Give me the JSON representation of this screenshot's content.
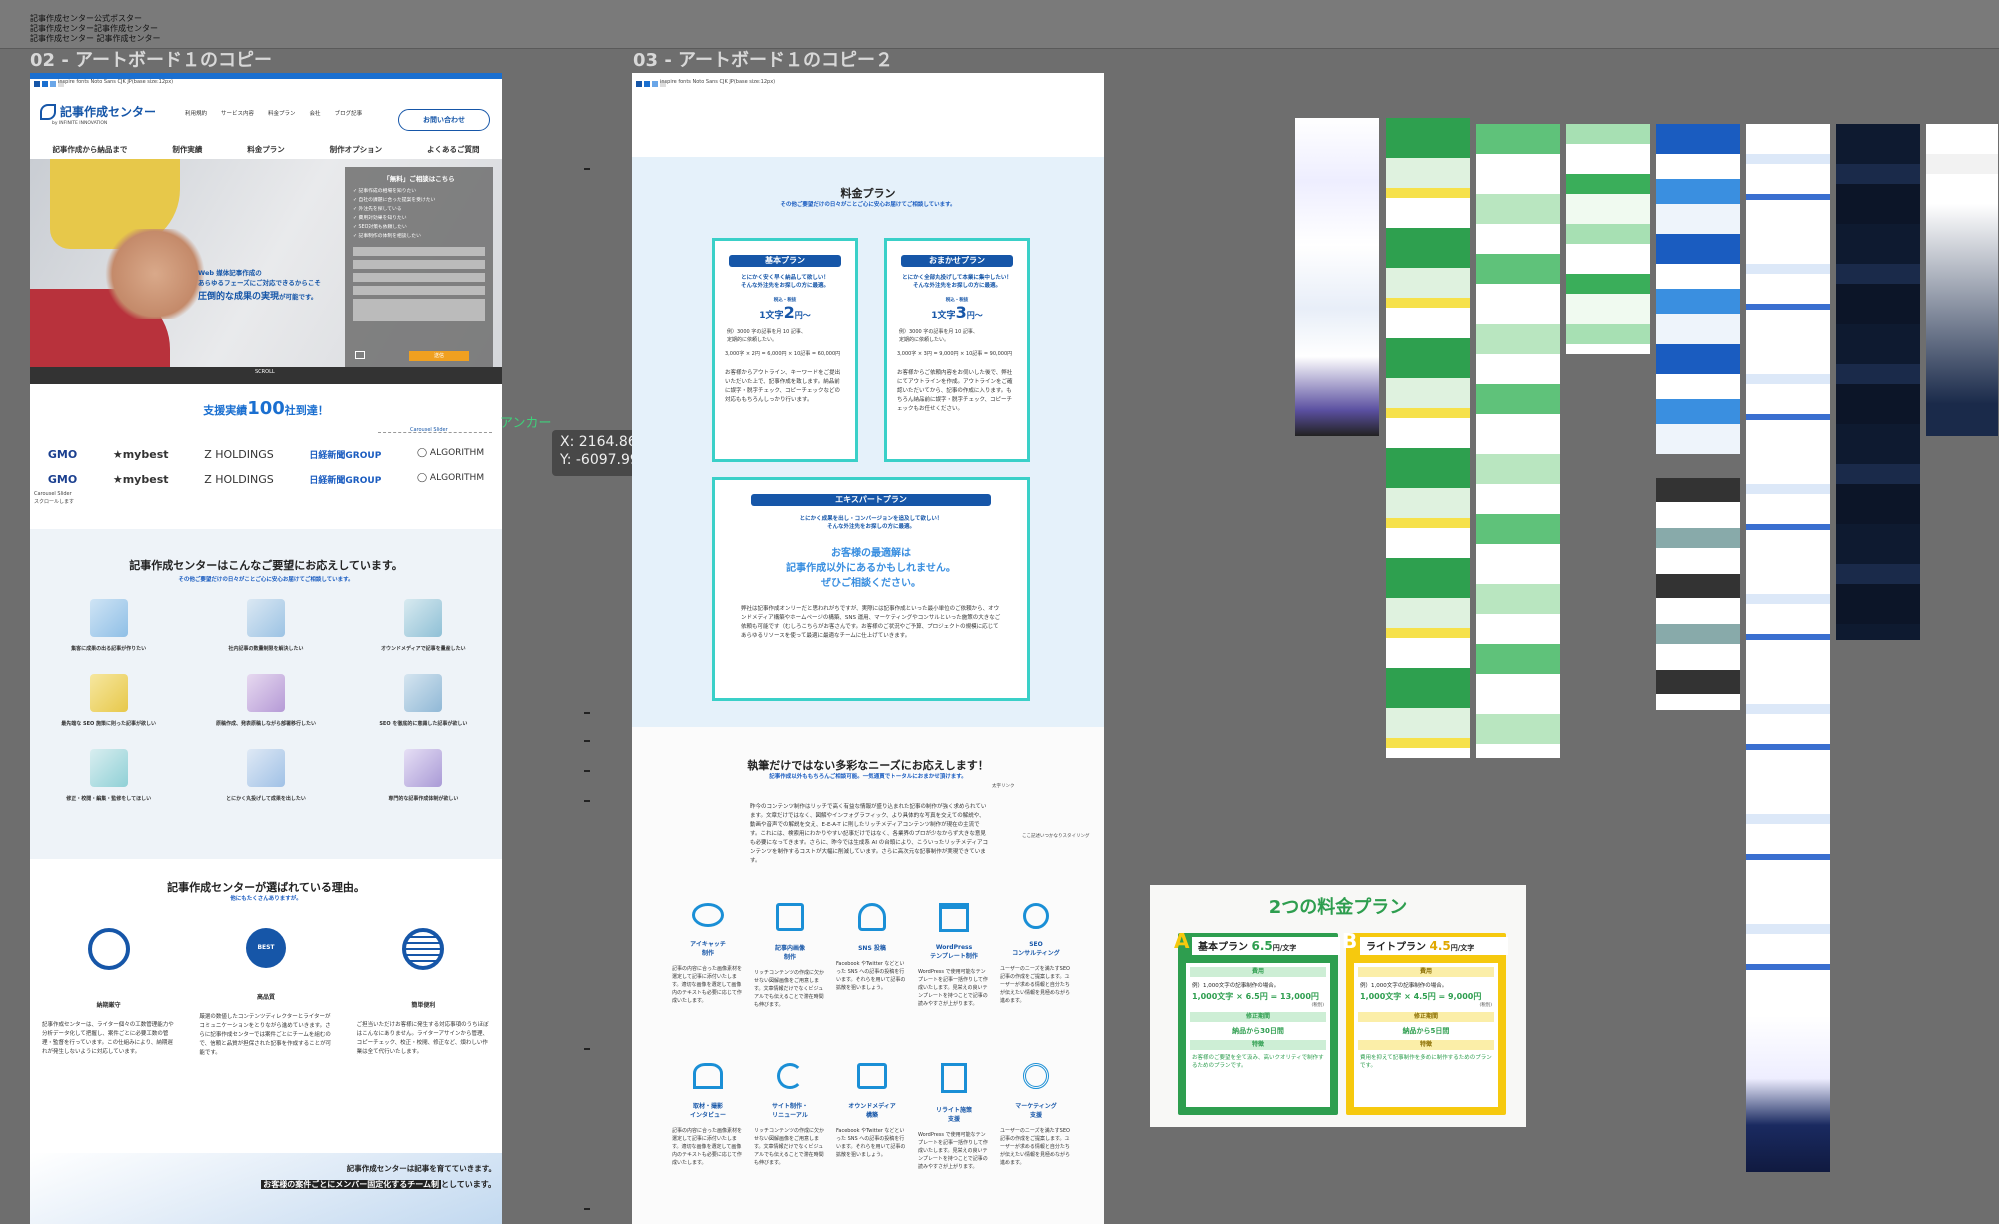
{
  "top_notes": [
    "記事作成センター公式ポスター",
    "記事作成センター記事作成センター",
    "記事作成センター 記事作成センター"
  ],
  "artboards": {
    "left_title": "02 - アートボード１のコピー",
    "right_title": "03 - アートボード１のコピー２"
  },
  "left": {
    "browser_note": "inspire fonts  Noto Sans CJK JP(base size:12px)",
    "logo_text": "記事作成センター",
    "logo_sub": "by INFINITE INNOVATION",
    "header_nav": [
      "利用規約",
      "サービス内容",
      "料金プラン",
      "会社",
      "ブログ記事"
    ],
    "contact_button": "お問い合わせ",
    "main_nav": [
      "記事作成から納品まで",
      "制作実績",
      "料金プラン",
      "制作オプション",
      "よくあるご質問"
    ],
    "hero_line1": "Web 媒体記事作成の",
    "hero_line2": "あらゆるフェーズにご対応できるからこそ",
    "hero_line3": "圧倒的な成果の実現",
    "hero_line3b": "が可能です。",
    "form_title": "「無料」ご相談はこちら",
    "form_items": [
      "✓ 記事作成の相場を知りたい",
      "✓ 自社の課題に合った提案を受けたい",
      "✓ 外注先を探している",
      "✓ 費用対効果を知りたい",
      "✓ SEO対策も依頼したい",
      "✓ 記事制作の体制を相談したい"
    ],
    "form_submit": "送信",
    "scroll_label": "SCROLL",
    "achievement_pre": "支援実績",
    "achievement_num": "100",
    "achievement_post": "社到達！",
    "logos_row1": [
      "GMO",
      "★mybest",
      "Z HOLDINGS",
      "日経新聞GROUP",
      "◯ ALGORITHM"
    ],
    "logos_row2": [
      "GMO",
      "★mybest",
      "Z HOLDINGS",
      "日経新聞GROUP",
      "◯ ALGORITHM"
    ],
    "carousel_label": "Carousel Slider",
    "carousel_note": "スクロールします",
    "needs_title": "記事作成センターはこんなご要望にお応えしています。",
    "needs_sub": "その他ご要望だけの日々がことご心に安心お届けてご相談しています。",
    "needs": [
      "集客に成果の出る記事が作りたい",
      "社内記事の数量制限を解決したい",
      "オウンドメディアで記事を量産したい",
      "最先端な SEO 施策に則った記事が欲しい",
      "原稿作成、発表原稿しながら部署移行したい",
      "SEO を徹底的に意識した記事が欲しい",
      "修正・校閲・編集・監修をしてほしい",
      "とにかく丸投げして成果を出したい",
      "専門的な記事作成体制が欲しい"
    ],
    "reasons_title": "記事作成センターが選ばれている理由。",
    "reasons_sub": "他にもたくさんありますが。",
    "reasons": [
      {
        "label": "納期厳守",
        "text": "記事作成センターは、ライター個々の工数管理能力や分析データ化して把握し、案件ごとに必要工数の管理・監督を行っています。この仕組みにより、納期遅れが発生しないように対応しています。"
      },
      {
        "label": "高品質",
        "text": "厳選の数値したコンテンツディレクターとライターがコミュニケーションをとりながら進めていきます。さらに記事作成センターでは案件ごとにチームを組むので、信頼と品質が担保された記事を作成することが可能です。"
      },
      {
        "label": "簡単便利",
        "text": "ご担当いただけお客様に発生する対応事項のうちほぼはこんなにありません。ライターアサインから管理、コピーチェック、校正・校閲、修正など、煩わしい作業は全て代行いたします。"
      }
    ],
    "footer_line1": "記事作成センターは記事を育てていきます。",
    "footer_line2_hl": "お客様の案件ごとにメンバー固定化するチーム制",
    "footer_line2_tail": "としています。"
  },
  "anchor": {
    "label": "アンカー",
    "x": "X: 2164.86 px",
    "y": "Y: -6097.99 px"
  },
  "right": {
    "browser_note": "inspire fonts  Noto Sans CJK JP(base size:12px)",
    "price_title": "料金プラン",
    "price_sub": "その他ご要望だけの日々がことご心に安心お届けてご相談しています。",
    "plans": [
      {
        "name": "基本プラン",
        "lead": "とにかく安く早く納品して欲しい！\nそんな外注先をお探しの方に最適。",
        "price_pre": "1文字",
        "price": "2",
        "price_post": "円〜",
        "price_note": "税込・税抜",
        "detail": "例）3000 字の記事を月 10 記事、\n定期的に依頼したい。",
        "calc": "3,000字 × 2円 = 6,000円 × 10記事 = 60,000円",
        "desc": "お客様からアウトライン、キーワードをご提出いただいた上で、記事作成を致します。納品前に誤字・脱字チェック、コピーチェックなどの対応ももちろんしっかり行います。"
      },
      {
        "name": "おまかせプラン",
        "lead": "とにかく全部丸投げして本業に集中したい！\nそんな外注先をお探しの方に最適。",
        "price_pre": "1文字",
        "price": "3",
        "price_post": "円〜",
        "price_note": "税込・税抜",
        "detail": "例）3000 字の記事を月 10 記事、\n定期的に依頼したい。",
        "calc": "3,000字 × 3円 = 9,000円 × 10記事 = 90,000円",
        "desc": "お客様からご依頼内容をお伺いした後で、弊社にてアウトラインを作成。アウトラインをご確認いただいてから、記事の作成に入ります。もちろん納品前に誤字・脱字チェック、コピーチェックもお任せください。"
      }
    ],
    "expert": {
      "name": "エキスパートプラン",
      "lead": "とにかく成果を出し・コンバージョンを追及して欲しい！\nそんな外注先をお探しの方に最適。",
      "big1": "お客様の最適解は",
      "big2": "記事作成以外にあるかもしれません。",
      "big3": "ぜひご相談ください。",
      "desc": "弊社は記事作成オンリーだと思われがちですが、実際には記事作成といった最小単位のご依頼から、オウンドメディア構築やホームページの構築、SNS 運用、マーケティングやコンサルといった施策の大きなご依頼も可能です（むしろこちらがお客さんです。お客様のご状況やご予算、プロジェクトの規模に応じてあらゆるリソースを使って最適に最適なチームに仕上げていきます。"
    },
    "needs_title": "執筆だけではない多彩なニーズにお応えします！",
    "needs_sub": "記事作成以外ももちろんご相談可能。一気通貫でトータルにおまかせ頂けます。",
    "needs_note1": "太字リンク",
    "needs_note2": "ここ記述いつかなりスタイリング",
    "needs_desc": "昨今のコンテンツ制作はリッチで高く有益な情報が盛り込まれた記事の制作が強く求められています。文章だけではなく、図解やインフォグラフィック、より具体的な写真を交えての解説や、動画や音声での解説を交え、E-E-A-T に則したリッチメディアコンテンツ制作が現在の主流です。これには、検索用にわかりやすい記事だけではなく、各業界のプロが少なからず大きな意見も必要になってきます。さらに、昨今では生成系 AI の台頭により、こういったリッチメディアコンテンツを制作するコストが大幅に削減しています。さらに高次元な記事制作が実現できています。",
    "services_row1": [
      {
        "label": "アイキャッチ\n制作",
        "text": "記事の内容に合った画像素材を選定して記事に添付いたします。適切な画像を選定して画像内のテキストも必要に応じて作成いたします。"
      },
      {
        "label": "記事内画像\n制作",
        "text": "リッチコンテンツの作成に欠かせない図解画像をご用意します。文章情報だけでなくビジュアルでも伝えることで滞在時間も伸びます。"
      },
      {
        "label": "SNS 投稿",
        "text": "Facebook やTwitter などといった SNS への記事の投稿を行います。それらを用いて記事の拡散を狙いましょう。"
      },
      {
        "label": "WordPress\nテンプレート制作",
        "text": "WordPress で使用可能なテンプレートを記事一括作りして作成いたします。見栄えの良いテンプレートを持つことで記事の読みやすさが上がります。"
      },
      {
        "label": "SEO\nコンサルティング",
        "text": "ユーザーのニーズを満たすSEO記事の作成をご提案します。ユーザーが求める情報と自分たちが伝えたい情報を見極めながら進めます。"
      }
    ],
    "services_row2": [
      {
        "label": "取材・撮影\nインタビュー",
        "text": "記事の内容に合った画像素材を選定して記事に添付いたします。適切な画像を選定して画像内のテキストも必要に応じて作成いたします。"
      },
      {
        "label": "サイト制作・\nリニューアル",
        "text": "リッチコンテンツの作成に欠かせない図解画像をご用意します。文章情報だけでなくビジュアルでも伝えることで滞在時間も伸びます。"
      },
      {
        "label": "オウンドメディア\n構築",
        "text": "Facebook やTwitter などといった SNS への記事の投稿を行います。それらを用いて記事の拡散を狙いましょう。"
      },
      {
        "label": "リライト施策\n支援",
        "text": "WordPress で使用可能なテンプレートを記事一括作りして作成いたします。見栄えの良いテンプレートを持つことで記事の読みやすさが上がります。"
      },
      {
        "label": "マーケティング\n支援",
        "text": "ユーザーのニーズを満たすSEO記事の作成をご提案します。ユーザーが求める情報と自分たちが伝えたい情報を見極めながら進めます。"
      }
    ]
  },
  "pricing_card": {
    "title": "2つの料金プラン",
    "planA_letter": "A",
    "planA": "基本プラン",
    "planA_price": "6.5",
    "planA_unit": "円/文字",
    "planB_letter": "B",
    "planB": "ライトプラン",
    "planB_price": "4.5",
    "planB_unit": "円/文字",
    "fee_label": "費用",
    "planA_example": "例）1,000文字の記事制作の場合。",
    "planA_calc": "1,000文字 × 6.5円 = 13,000円",
    "planB_example": "例）1,000文字の記事制作の場合。",
    "planB_calc": "1,000文字 × 4.5円 = 9,000円",
    "tax_note": "(税別)",
    "period_label": "修正期間",
    "planA_period": "納品から30日間",
    "planB_period": "納品から5日間",
    "feature_label": "特徴",
    "planA_feature": "お客様のご要望を全て汲み、高いクオリティで制作するためのプランです。",
    "planB_feature": "費用を抑えて記事制作を多めに制作するためのプランです。"
  },
  "colors": {
    "canvas": "#6e6e6e",
    "brand_blue": "#1656a8",
    "plan_border": "#3ad0c8",
    "green": "#2e9e4f",
    "yellow": "#f6c90e"
  }
}
